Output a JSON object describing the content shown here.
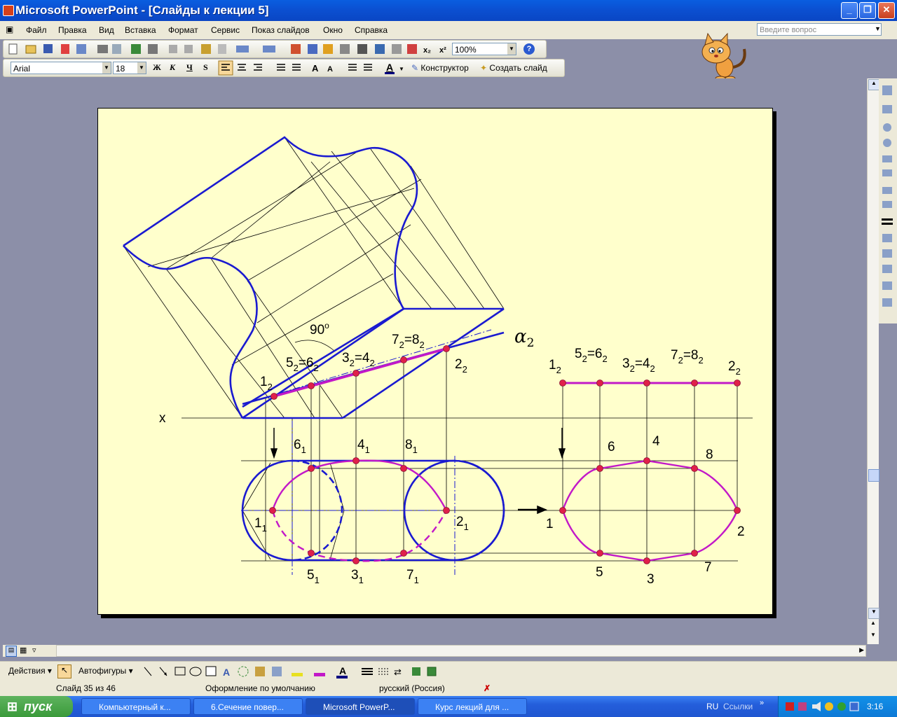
{
  "window": {
    "title": "Microsoft PowerPoint - [Слайды к лекции 5]"
  },
  "menu": {
    "items": [
      "Файл",
      "Правка",
      "Вид",
      "Вставка",
      "Формат",
      "Сервис",
      "Показ слайдов",
      "Окно",
      "Справка"
    ],
    "ask_placeholder": "Введите вопрос"
  },
  "toolbar": {
    "zoom": "100%",
    "font_name": "Arial",
    "font_size": "18",
    "bold": "Ж",
    "italic": "К",
    "underline": "Ч",
    "shadow": "S",
    "designer": "Конструктор",
    "new_slide": "Создать слайд"
  },
  "slide": {
    "alpha_label": "α",
    "alpha_sub": "2",
    "angle_label": "90",
    "angle_sup": "o",
    "x_axis": "x",
    "front_labels": [
      {
        "main": "1",
        "sub": "2"
      },
      {
        "main": "5",
        "sub": "2",
        "eq": "=6",
        "sub2": "2"
      },
      {
        "main": "3",
        "sub": "2",
        "eq": "=4",
        "sub2": "2"
      },
      {
        "main": "7",
        "sub": "2",
        "eq": "=8",
        "sub2": "2"
      },
      {
        "main": "2",
        "sub": "2"
      }
    ],
    "top_labels": [
      {
        "main": "6",
        "sub": "1"
      },
      {
        "main": "4",
        "sub": "1"
      },
      {
        "main": "8",
        "sub": "1"
      },
      {
        "main": "1",
        "sub": "1"
      },
      {
        "main": "2",
        "sub": "1"
      },
      {
        "main": "5",
        "sub": "1"
      },
      {
        "main": "3",
        "sub": "1"
      },
      {
        "main": "7",
        "sub": "1"
      }
    ],
    "right_top_labels": [
      {
        "main": "1",
        "sub": "2"
      },
      {
        "main": "5",
        "sub": "2",
        "eq": "=6",
        "sub2": "2"
      },
      {
        "main": "3",
        "sub": "2",
        "eq": "=4",
        "sub2": "2"
      },
      {
        "main": "7",
        "sub": "2",
        "eq": "=8",
        "sub2": "2"
      },
      {
        "main": "2",
        "sub": "2"
      }
    ],
    "right_true_labels": [
      "6",
      "4",
      "8",
      "1",
      "2",
      "5",
      "3",
      "7"
    ]
  },
  "drawing_toolbar": {
    "actions": "Действия",
    "autoshapes": "Автофигуры"
  },
  "status": {
    "slide": "Слайд 35 из 46",
    "design": "Оформление по умолчанию",
    "language": "русский (Россия)"
  },
  "taskbar": {
    "start": "пуск",
    "tasks": [
      "Компьютерный к...",
      "6.Сечение повер...",
      "Microsoft PowerP...",
      "Курс лекций для ..."
    ],
    "tray_lang": "RU",
    "tray_links": "Ссылки",
    "clock": "3:16"
  },
  "colors": {
    "slide_bg": "#ffffcc",
    "blue": "#1a1ad0",
    "magenta": "#c218c8",
    "point": "#e0204a"
  }
}
